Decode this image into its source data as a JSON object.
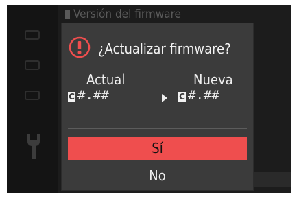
{
  "background": {
    "header_text": "Versión del firmware"
  },
  "dialog": {
    "title": "¿Actualizar firmware?",
    "current_label": "Actual",
    "new_label": "Nueva",
    "current_version": "#.##",
    "new_version": "#.##",
    "version_prefix_glyph": "C",
    "warning_icon": "warning-exclamation-icon",
    "arrow_icon": "right-arrow-icon"
  },
  "buttons": {
    "yes_label": "Sí",
    "no_label": "No"
  },
  "colors": {
    "screen_bg": "#1c1c1c",
    "dialog_bg": "#3b3b3b",
    "accent_red": "#ef4e4e",
    "text": "#eeeeee"
  }
}
